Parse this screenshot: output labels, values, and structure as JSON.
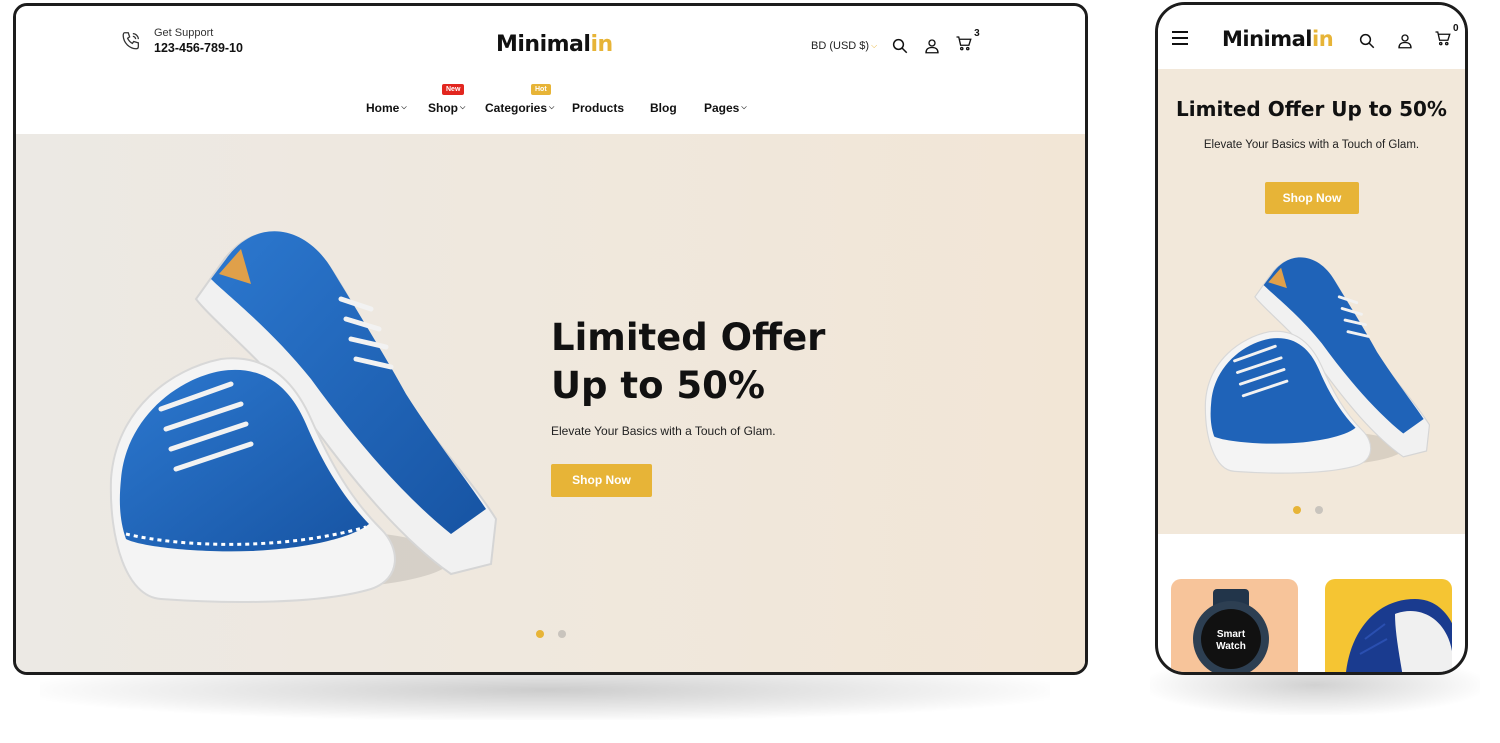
{
  "desktop": {
    "support": {
      "label": "Get Support",
      "phone": "123-456-789-10"
    },
    "logo": {
      "part1": "Minimal",
      "part2": "in"
    },
    "currency": "BD (USD $)",
    "cart_count": "3",
    "nav": [
      {
        "label": "Home",
        "badge": ""
      },
      {
        "label": "Shop",
        "badge": "New"
      },
      {
        "label": "Categories",
        "badge": "Hot"
      },
      {
        "label": "Products",
        "badge": ""
      },
      {
        "label": "Blog",
        "badge": ""
      },
      {
        "label": "Pages",
        "badge": ""
      }
    ],
    "hero": {
      "title_line1": "Limited Offer",
      "title_line2": "Up to 50%",
      "subtitle": "Elevate Your Basics with a Touch of Glam.",
      "button": "Shop Now",
      "slides": 2,
      "active_slide": 1
    }
  },
  "mobile": {
    "logo": {
      "part1": "Minimal",
      "part2": "in"
    },
    "cart_count": "0",
    "hero": {
      "title": "Limited Offer Up to 50%",
      "subtitle": "Elevate Your Basics with a Touch of Glam.",
      "button": "Shop Now",
      "slides": 2,
      "active_slide": 1
    },
    "watch_text": {
      "line1": "Smart",
      "line2": "Watch"
    }
  },
  "colors": {
    "accent": "#e7b437",
    "badge_new": "#e2261f",
    "hero_bg": "#f2e8da",
    "shoe_blue": "#1f63b8"
  },
  "icons": [
    "phone-icon",
    "search-icon",
    "user-icon",
    "cart-icon",
    "chevron-down-icon",
    "hamburger-icon"
  ]
}
